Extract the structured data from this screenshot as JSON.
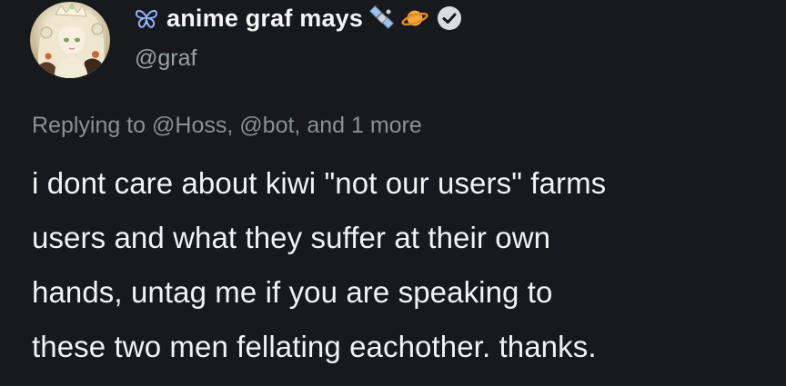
{
  "author": {
    "display_name": "anime graf mays",
    "handle": "@graf",
    "name_prefix_icon": "butterfly-outline-icon",
    "name_suffix_emojis": [
      "satellite-emoji",
      "ringed-planet-emoji"
    ],
    "verified_icon": "verified-check-icon",
    "avatar_icon": "anime-avatar"
  },
  "reply": {
    "prefix": "Replying to",
    "mention_1": "@Hoss,",
    "mention_2": "@bot,",
    "suffix": "and 1 more"
  },
  "post": {
    "lines": [
      "i dont care about kiwi \"not our users\" farms",
      "users and what they suffer at their own",
      "hands, untag me if you are speaking to",
      "these two men fellating eachother. thanks."
    ]
  },
  "colors": {
    "background": "#17191c",
    "text_primary": "#f2f2f2",
    "text_secondary": "#8b9097",
    "verified_badge": "#d9dde1",
    "butterfly_icon": "#8fb3ff"
  }
}
